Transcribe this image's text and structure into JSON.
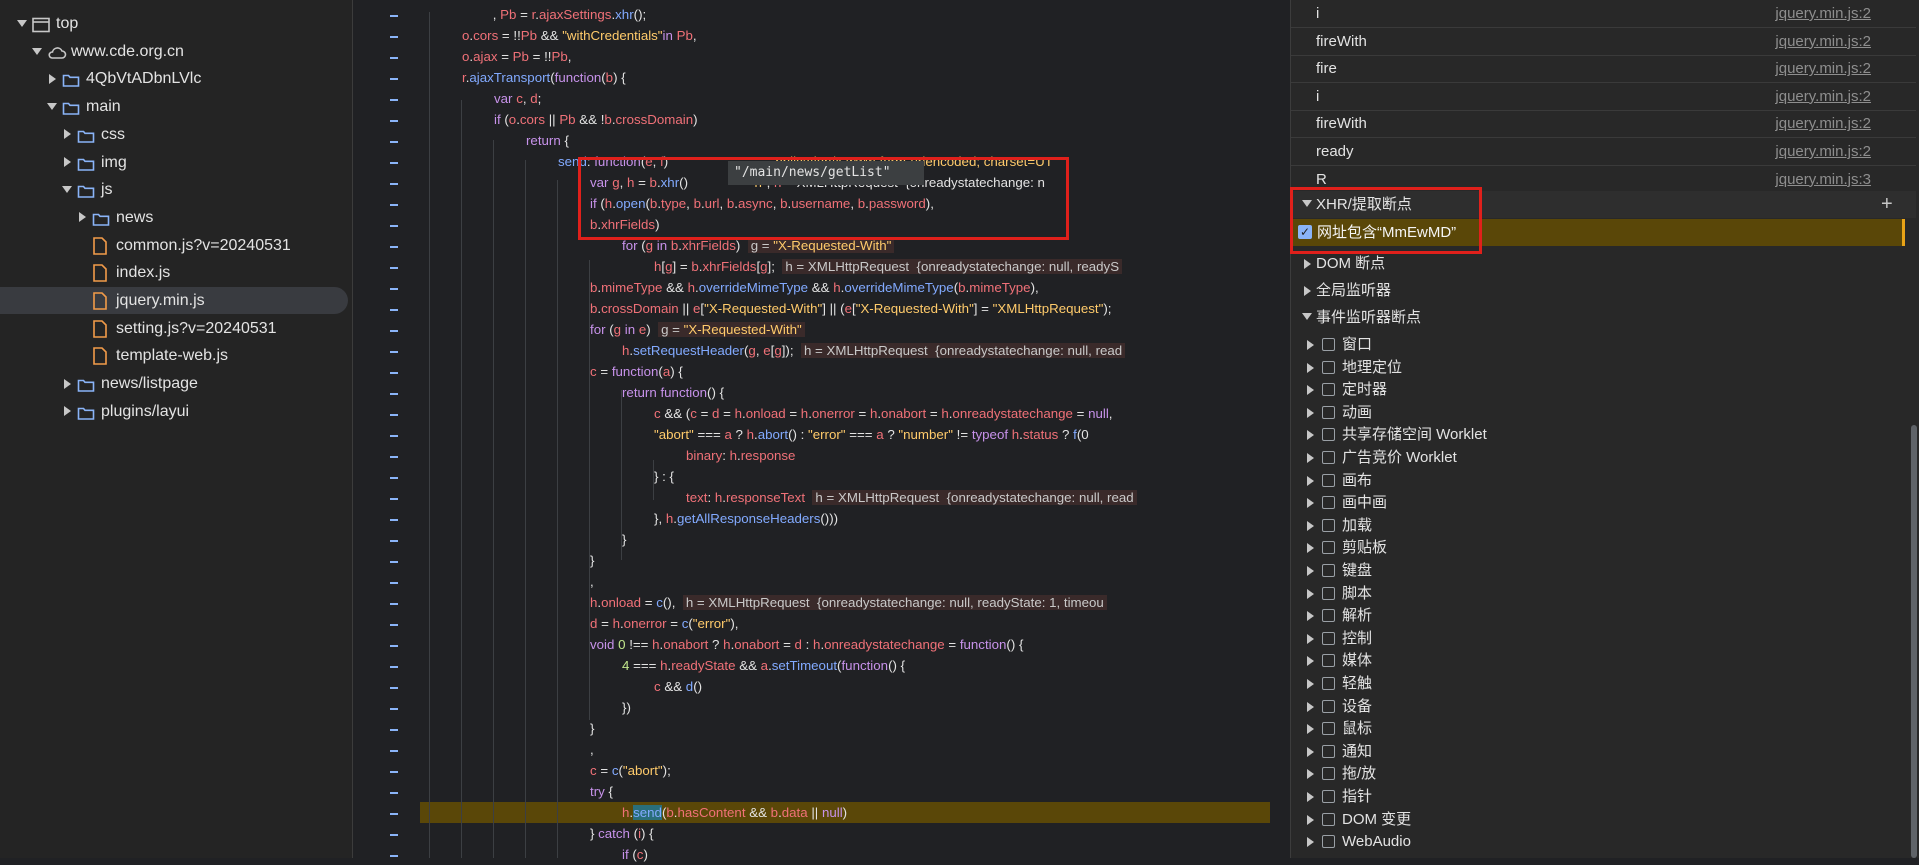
{
  "tree": {
    "items": [
      {
        "label": "top",
        "icon": "window-icon",
        "expanded": true
      },
      {
        "label": "www.cde.org.cn",
        "icon": "cloud-icon",
        "expanded": true
      },
      {
        "label": "4QbVtADbnLVlc",
        "icon": "folder-icon",
        "expanded": false
      },
      {
        "label": "main",
        "icon": "folder-icon",
        "expanded": true
      },
      {
        "label": "css",
        "icon": "folder-icon",
        "expanded": false
      },
      {
        "label": "img",
        "icon": "folder-icon",
        "expanded": false
      },
      {
        "label": "js",
        "icon": "folder-icon",
        "expanded": true
      },
      {
        "label": "news",
        "icon": "folder-icon",
        "expanded": false
      },
      {
        "label": "common.js?v=20240531",
        "icon": "file-icon"
      },
      {
        "label": "index.js",
        "icon": "file-icon"
      },
      {
        "label": "jquery.min.js",
        "icon": "file-icon",
        "selected": true
      },
      {
        "label": "setting.js?v=20240531",
        "icon": "file-icon"
      },
      {
        "label": "template-web.js",
        "icon": "file-icon"
      },
      {
        "label": "news/listpage",
        "icon": "folder-icon",
        "expanded": false
      },
      {
        "label": "plugins/layui",
        "icon": "folder-icon",
        "expanded": false
      }
    ]
  },
  "editor": {
    "tooltip": "\"/main/news/getList\"",
    "lines": [
      {
        "i": 6,
        "h": "    , <span class='var'>Pb</span> = <span class='var'>r</span>.<span class='var'>ajaxSettings</span>.<span class='fn'>xhr</span>();"
      },
      {
        "i": 4,
        "h": "<span class='var'>o</span>.<span class='var'>cors</span> = !!<span class='var'>Pb</span> &amp;&amp; <span class='str'>\"withCredentials\"</span><span class='kw'>in</span> <span class='var'>Pb</span>,"
      },
      {
        "i": 4,
        "h": "<span class='var'>o</span>.<span class='var'>ajax</span> = <span class='var'>Pb</span> = !!<span class='var'>Pb</span>,"
      },
      {
        "i": 4,
        "h": "<span class='var'>r</span>.<span class='fn'>ajaxTransport</span>(<span class='kw'>function</span>(<span class='var'>b</span>) {"
      },
      {
        "i": 8,
        "h": "<span class='kw'>var</span> <span class='var'>c</span>, <span class='var'>d</span>;"
      },
      {
        "i": 8,
        "h": "<span class='kw'>if</span> (<span class='var'>o</span>.<span class='var'>cors</span> || <span class='var'>Pb</span> &amp;&amp; !<span class='var'>b</span>.<span class='var'>crossDomain</span>)"
      },
      {
        "i": 12,
        "h": "<span class='kw'>return</span> {"
      },
      {
        "i": 16,
        "h": "<span class='fn'>send</span>: <span class='kw'>function</span>(<span class='var'>e</span>, <span class='var'>f</span>)                             <span class='str'>pplication/x-www-form-urlencoded; charset=UT</span>"
      },
      {
        "i": 20,
        "h": "<span class='kw'>var</span> <span class='var'>g</span>, <span class='var'>h</span> = <span class='var'>b</span>.<span class='fn'>xhr</span>()                  <span class='str'>n\"</span>, <span class='var'>h</span> = XMLHttpRequest  {onreadystatechange: n"
      },
      {
        "i": 20,
        "h": "<span class='kw'>if</span> (<span class='var'>h</span>.<span class='fn'>open</span>(<span class='var'>b</span>.<span class='var'>type</span>, <span class='var'>b</span>.<span class='var'>url</span>, <span class='var'>b</span>.<span class='var'>async</span>, <span class='var'>b</span>.<span class='var'>username</span>, <span class='var'>b</span>.<span class='var'>password</span>),"
      },
      {
        "i": 20,
        "h": "<span class='var'>b</span>.<span class='var'>xhrFields</span>)"
      },
      {
        "i": 24,
        "h": "<span class='kw'>for</span> (<span class='var'>g</span> <span class='kw'>in</span> <span class='var'>b</span>.<span class='var'>xhrFields</span>)  <span class='inl'>g = <span class='str'>\"X-Requested-With\"</span></span>"
      },
      {
        "i": 28,
        "h": "<span class='var'>h</span>[<span class='var'>g</span>] = <span class='var'>b</span>.<span class='var'>xhrFields</span>[<span class='var'>g</span>];  <span class='inl'>h = XMLHttpRequest  {onreadystatechange: null, readyS</span>"
      },
      {
        "i": 20,
        "h": "<span class='var'>b</span>.<span class='var'>mimeType</span> &amp;&amp; <span class='var'>h</span>.<span class='fn'>overrideMimeType</span> &amp;&amp; <span class='var'>h</span>.<span class='fn'>overrideMimeType</span>(<span class='var'>b</span>.<span class='var'>mimeType</span>),"
      },
      {
        "i": 20,
        "h": "<span class='var'>b</span>.<span class='var'>crossDomain</span> || <span class='var'>e</span>[<span class='str'>\"X-Requested-With\"</span>] || (<span class='var'>e</span>[<span class='str'>\"X-Requested-With\"</span>] = <span class='str'>\"XMLHttpRequest\"</span>);"
      },
      {
        "i": 20,
        "h": "<span class='kw'>for</span> (<span class='var'>g</span> <span class='kw'>in</span> <span class='var'>e</span>)  <span class='inl'>g = <span class='str'>\"X-Requested-With\"</span></span>"
      },
      {
        "i": 24,
        "h": "<span class='var'>h</span>.<span class='fn'>setRequestHeader</span>(<span class='var'>g</span>, <span class='var'>e</span>[<span class='var'>g</span>]);  <span class='inl'>h = XMLHttpRequest  {onreadystatechange: null, read</span>"
      },
      {
        "i": 20,
        "h": "<span class='var'>c</span> = <span class='kw'>function</span>(<span class='var'>a</span>) {"
      },
      {
        "i": 24,
        "h": "<span class='kw'>return</span> <span class='kw'>function</span>() {"
      },
      {
        "i": 28,
        "h": "<span class='var'>c</span> &amp;&amp; (<span class='var'>c</span> = <span class='var'>d</span> = <span class='var'>h</span>.<span class='var'>onload</span> = <span class='var'>h</span>.<span class='var'>onerror</span> = <span class='var'>h</span>.<span class='var'>onabort</span> = <span class='var'>h</span>.<span class='var'>onreadystatechange</span> = <span class='kw'>null</span>,"
      },
      {
        "i": 28,
        "h": "<span class='str'>\"abort\"</span> === <span class='var'>a</span> ? <span class='var'>h</span>.<span class='fn'>abort</span>() : <span class='str'>\"error\"</span> === <span class='var'>a</span> ? <span class='str'>\"number\"</span> != <span class='kw'>typeof</span> <span class='var'>h</span>.<span class='var'>status</span> ? <span class='fn'>f</span>(0"
      },
      {
        "i": 32,
        "h": "<span class='var'>binary</span>: <span class='var'>h</span>.<span class='var'>response</span>"
      },
      {
        "i": 28,
        "h": "} : {"
      },
      {
        "i": 32,
        "h": "<span class='var'>text</span>: <span class='var'>h</span>.<span class='var'>responseText</span>  <span class='inl'>h = XMLHttpRequest  {onreadystatechange: null, read</span>"
      },
      {
        "i": 28,
        "h": "}, <span class='var'>h</span>.<span class='fn'>getAllResponseHeaders</span>()))"
      },
      {
        "i": 24,
        "h": "}"
      },
      {
        "i": 20,
        "h": "}"
      },
      {
        "i": 20,
        "h": ","
      },
      {
        "i": 20,
        "h": "<span class='var'>h</span>.<span class='var'>onload</span> = <span class='fn'>c</span>(),  <span class='inl'>h = XMLHttpRequest  {onreadystatechange: null, readyState: 1, timeou</span>"
      },
      {
        "i": 20,
        "h": "<span class='var'>d</span> = <span class='var'>h</span>.<span class='var'>onerror</span> = <span class='fn'>c</span>(<span class='str'>\"error\"</span>),"
      },
      {
        "i": 20,
        "h": "<span class='kw'>void</span> <span class='num'>0</span> !== <span class='var'>h</span>.<span class='var'>onabort</span> ? <span class='var'>h</span>.<span class='var'>onabort</span> = <span class='var'>d</span> : <span class='var'>h</span>.<span class='var'>onreadystatechange</span> = <span class='kw'>function</span>() {"
      },
      {
        "i": 24,
        "h": "<span class='num'>4</span> === <span class='var'>h</span>.<span class='var'>readyState</span> &amp;&amp; <span class='var'>a</span>.<span class='fn'>setTimeout</span>(<span class='kw'>function</span>() {"
      },
      {
        "i": 28,
        "h": "<span class='var'>c</span> &amp;&amp; <span class='fn'>d</span>()"
      },
      {
        "i": 24,
        "h": "})"
      },
      {
        "i": 20,
        "h": "}"
      },
      {
        "i": 20,
        "h": ","
      },
      {
        "i": 20,
        "h": "<span class='var'>c</span> = <span class='fn'>c</span>(<span class='str'>\"abort\"</span>);"
      },
      {
        "i": 20,
        "h": "<span class='kw'>try</span> {"
      },
      {
        "i": 24,
        "h": "<span class='var'>h</span>.<span class='fn' style='background:#2a6e7a'>send</span>(<span class='var'>b</span>.<span class='var'>hasContent</span> &amp;&amp; <span class='var'>b</span>.<span class='var'>data</span> || <span class='kw'>null</span>)"
      },
      {
        "i": 20,
        "h": "} <span class='kw'>catch</span> (<span class='var'>i</span>) {"
      },
      {
        "i": 24,
        "h": "<span class='kw'>if</span> (<span class='var'>c</span>)"
      }
    ]
  },
  "callstack": {
    "frames": [
      {
        "name": "i",
        "loc": "jquery.min.js:2"
      },
      {
        "name": "fireWith",
        "loc": "jquery.min.js:2"
      },
      {
        "name": "fire",
        "loc": "jquery.min.js:2"
      },
      {
        "name": "i",
        "loc": "jquery.min.js:2"
      },
      {
        "name": "fireWith",
        "loc": "jquery.min.js:2"
      },
      {
        "name": "ready",
        "loc": "jquery.min.js:2"
      },
      {
        "name": "R",
        "loc": "jquery.min.js:3"
      }
    ]
  },
  "xhr_section": {
    "title": "XHR/提取断点",
    "add_label": "+",
    "breakpoint": {
      "label": "网址包含“MmEwMD”",
      "checked": true
    }
  },
  "sections": [
    {
      "title": "DOM 断点"
    },
    {
      "title": "全局监听器"
    },
    {
      "title": "事件监听器断点"
    }
  ],
  "event_listeners": [
    "窗口",
    "地理定位",
    "定时器",
    "动画",
    "共享存储空间 Worklet",
    "广告竞价 Worklet",
    "画布",
    "画中画",
    "加载",
    "剪贴板",
    "键盘",
    "脚本",
    "解析",
    "控制",
    "媒体",
    "轻触",
    "设备",
    "鼠标",
    "通知",
    "拖/放",
    "指针",
    "DOM 变更",
    "WebAudio"
  ],
  "colors": {
    "breakpoint_highlight": "#5a4708",
    "annotation_box": "#e0201b",
    "link_blue": "#8ab4f8"
  }
}
